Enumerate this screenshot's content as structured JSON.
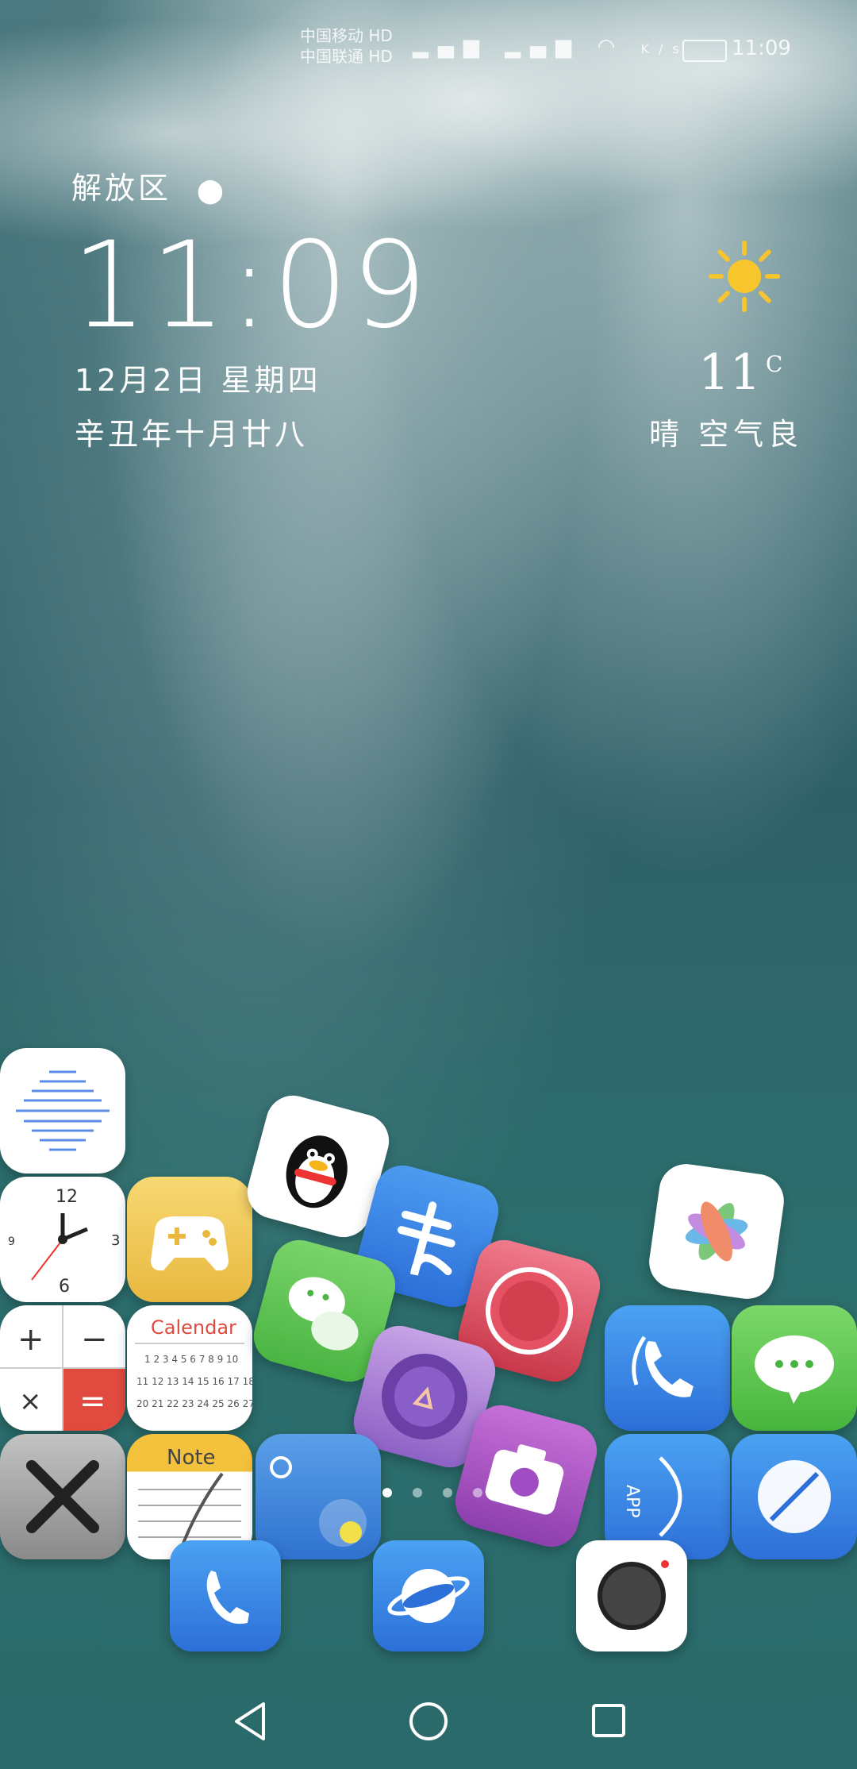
{
  "status_bar": {
    "carrier1": "中国移动 HD",
    "carrier2": "中国联通 HD",
    "speed": "K/s",
    "time": "11:09"
  },
  "lockwidget": {
    "location": "解放区",
    "time": "11:09",
    "date": "12月2日 星期四",
    "lunar": "辛丑年十月廿八",
    "temperature": "11",
    "temp_unit": "C",
    "weather": "晴 空气良"
  },
  "dock": {
    "page_count": 4,
    "active_page": 0
  },
  "icons": {
    "phone": "phone-icon",
    "browser": "planet-icon",
    "camera": "camera-icon"
  }
}
